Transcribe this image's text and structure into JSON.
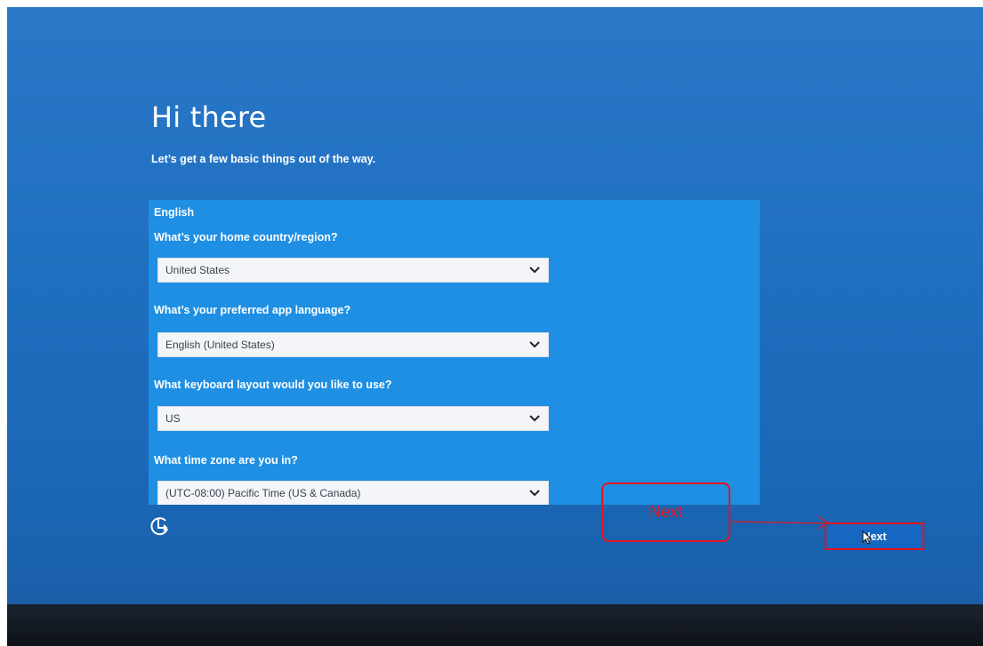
{
  "setup": {
    "title": "Hi there",
    "subtitle": "Let’s get a few basic things out of the way.",
    "language_header": "English",
    "questions": [
      {
        "label": "What’s your home country/region?",
        "value": "United States"
      },
      {
        "label": "What’s your preferred app language?",
        "value": "English (United States)"
      },
      {
        "label": "What keyboard layout would you like to use?",
        "value": "US"
      },
      {
        "label": "What time zone are you in?",
        "value": "(UTC-08:00) Pacific Time (US & Canada)"
      }
    ],
    "next_label": "Next"
  },
  "annotation": {
    "callout_text": "Next"
  },
  "icons": {
    "accessibility": "ease-of-access-icon",
    "dropdown": "chevron-down-icon",
    "cursor": "mouse-cursor-icon"
  },
  "colors": {
    "background": "#1f6fc0",
    "panel": "#1e8fe3",
    "annotation_red": "#e4151c"
  }
}
